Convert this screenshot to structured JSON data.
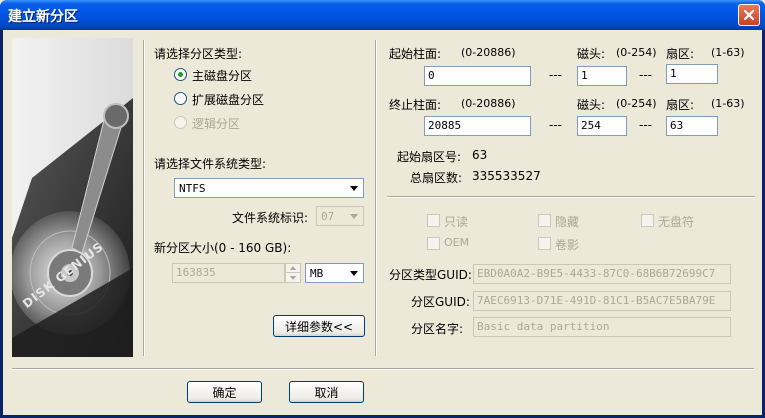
{
  "window": {
    "title": "建立新分区"
  },
  "partition_type": {
    "label": "请选择分区类型:",
    "options": [
      {
        "label": "主磁盘分区",
        "selected": true,
        "enabled": true
      },
      {
        "label": "扩展磁盘分区",
        "selected": false,
        "enabled": true
      },
      {
        "label": "逻辑分区",
        "selected": false,
        "enabled": false
      }
    ]
  },
  "filesystem": {
    "label": "请选择文件系统类型:",
    "value": "NTFS",
    "id_label": "文件系统标识:",
    "id_value": "07"
  },
  "size": {
    "label": "新分区大小(0 - 160 GB):",
    "value": "163835",
    "unit": "MB"
  },
  "details_button": "详细参数<<",
  "geometry": {
    "start_cyl_label": "起始柱面:",
    "start_cyl_range": "(0-20886)",
    "start_cyl_value": "0",
    "start_head_label": "磁头:",
    "start_head_range": "(0-254)",
    "start_head_value": "1",
    "start_sector_label": "扇区:",
    "start_sector_range": "(1-63)",
    "start_sector_value": "1",
    "end_cyl_label": "终止柱面:",
    "end_cyl_range": "(0-20886)",
    "end_cyl_value": "20885",
    "end_head_label": "磁头:",
    "end_head_range": "(0-254)",
    "end_head_value": "254",
    "end_sector_label": "扇区:",
    "end_sector_range": "(1-63)",
    "end_sector_value": "63",
    "dash": "---",
    "start_lba_label": "起始扇区号:",
    "start_lba_value": "63",
    "total_sectors_label": "总扇区数:",
    "total_sectors_value": "335533527"
  },
  "attributes": {
    "readonly": "只读",
    "hidden": "隐藏",
    "no_drive_letter": "无盘符",
    "oem": "OEM",
    "shadow": "卷影"
  },
  "guid": {
    "type_guid_label": "分区类型GUID:",
    "type_guid_value": "EBD0A0A2-B9E5-4433-87C0-68B6B72699C7",
    "part_guid_label": "分区GUID:",
    "part_guid_value": "7AEC6913-D71E-491D-81C1-B5AC7E5BA79E",
    "name_label": "分区名字:",
    "name_value": "Basic data partition"
  },
  "buttons": {
    "ok": "确定",
    "cancel": "取消"
  },
  "logo_text": "DISK GENIUS"
}
